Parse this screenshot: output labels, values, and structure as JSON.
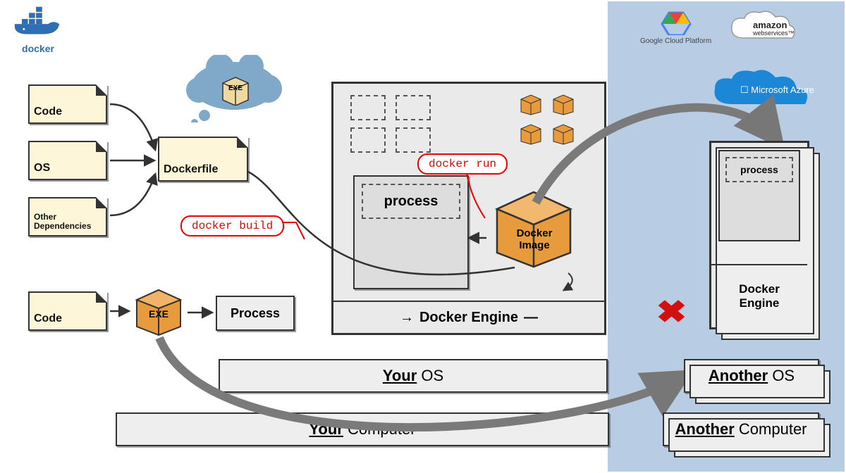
{
  "logo": {
    "name": "docker"
  },
  "files": {
    "code1": "Code",
    "os": "OS",
    "deps": "Other Dependencies",
    "dockerfile": "Dockerfile",
    "code2": "Code"
  },
  "exe_cube": "EXE",
  "exe_cloud": "EXE",
  "process_label": "Process",
  "panel": {
    "process": "process",
    "docker_image": "Docker\nImage",
    "engine": "Docker Engine"
  },
  "callouts": {
    "build": "docker build",
    "run": "docker run"
  },
  "your_os": {
    "u": "Your",
    "rest": " OS"
  },
  "your_computer": {
    "u": "Your",
    "rest": " Computer"
  },
  "remote": {
    "process": "process",
    "engine": "Docker\nEngine",
    "another_os": {
      "u": "Another",
      "rest": " OS"
    },
    "another_computer": {
      "u": "Another",
      "rest": " Computer"
    }
  },
  "clouds": {
    "gcp": "Google Cloud Platform",
    "aws1": "amazon",
    "aws2": "webservices™",
    "azure": "Microsoft Azure"
  }
}
